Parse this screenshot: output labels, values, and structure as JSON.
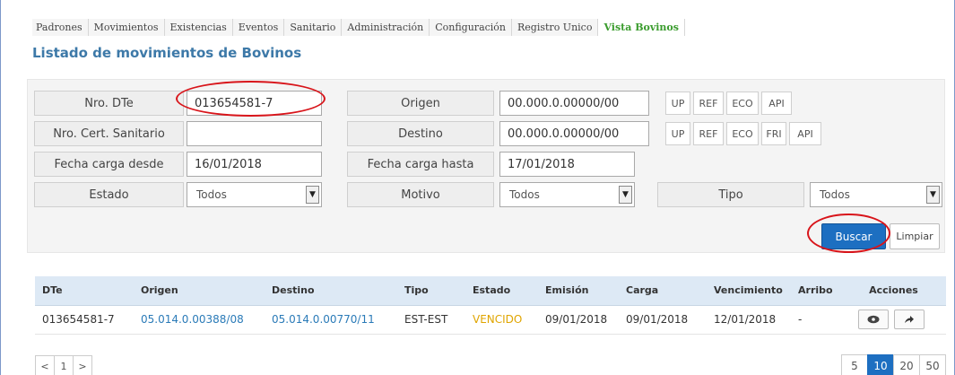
{
  "nav": {
    "items": [
      "Padrones",
      "Movimientos",
      "Existencias",
      "Eventos",
      "Sanitario",
      "Administración",
      "Configuración",
      "Registro Unico",
      "Vista Bovinos"
    ],
    "active": "Vista Bovinos"
  },
  "page": {
    "title": "Listado de movimientos de Bovinos"
  },
  "filters": {
    "nro_dte": {
      "label": "Nro. DTe",
      "value": "013654581-7"
    },
    "nro_cert": {
      "label": "Nro. Cert. Sanitario",
      "value": ""
    },
    "fecha_desde": {
      "label": "Fecha carga desde",
      "value": "16/01/2018"
    },
    "fecha_hasta": {
      "label": "Fecha carga hasta",
      "value": "17/01/2018"
    },
    "origen": {
      "label": "Origen",
      "value": "00.000.0.00000/00",
      "buttons": [
        "UP",
        "REF",
        "ECO",
        "API"
      ]
    },
    "destino": {
      "label": "Destino",
      "value": "00.000.0.00000/00",
      "buttons": [
        "UP",
        "REF",
        "ECO",
        "FRI",
        "API"
      ]
    },
    "estado": {
      "label": "Estado",
      "value": "Todos"
    },
    "motivo": {
      "label": "Motivo",
      "value": "Todos"
    },
    "tipo": {
      "label": "Tipo",
      "value": "Todos"
    },
    "buscar_label": "Buscar",
    "limpiar_label": "Limpiar"
  },
  "table": {
    "headers": [
      "DTe",
      "Origen",
      "Destino",
      "Tipo",
      "Estado",
      "Emisión",
      "Carga",
      "Vencimiento",
      "Arribo",
      "Acciones"
    ],
    "rows": [
      {
        "dte": "013654581-7",
        "origen": "05.014.0.00388/08",
        "destino": "05.014.0.00770/11",
        "tipo": "EST-EST",
        "estado": "VENCIDO",
        "emision": "09/01/2018",
        "carga": "09/01/2018",
        "vencimiento": "12/01/2018",
        "arribo": "-",
        "actions": [
          "eye-icon",
          "arrow-right-icon"
        ]
      }
    ]
  },
  "pagination": {
    "prev": "<",
    "page": "1",
    "next": ">",
    "sizes": [
      "5",
      "10",
      "20",
      "50"
    ],
    "active_size": "10"
  },
  "colors": {
    "primary": "#1d6fc1",
    "title": "#3d79a8",
    "active_nav": "#3b9c2e",
    "link": "#2b7bb8",
    "status_vencido": "#e0a500",
    "highlight_ring": "#d8141a"
  }
}
